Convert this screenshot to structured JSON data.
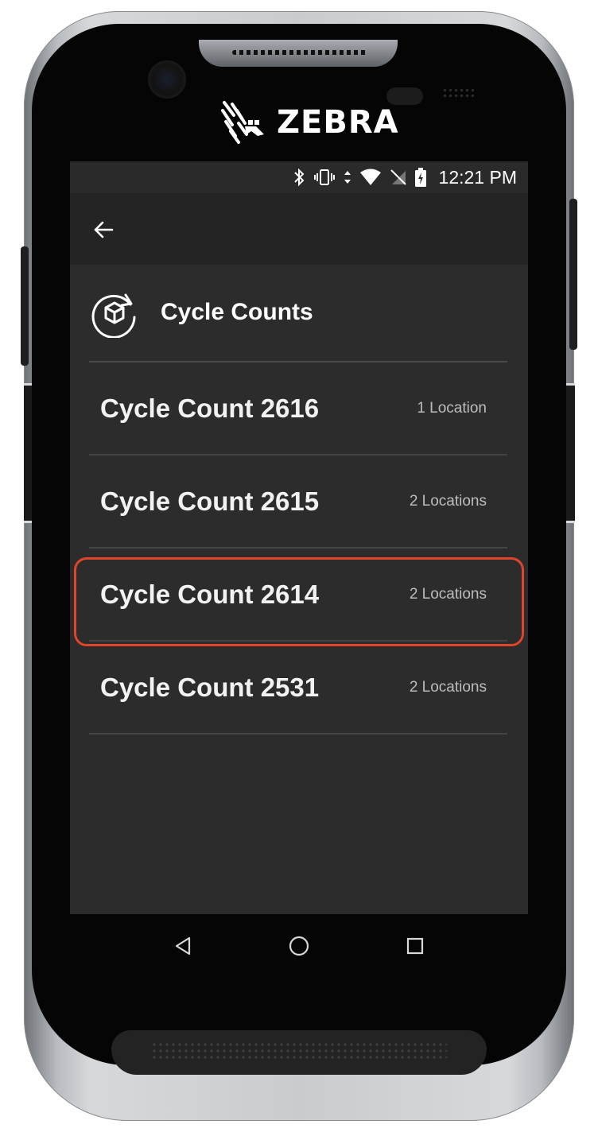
{
  "device": {
    "brand": "ZEBRA"
  },
  "status_bar": {
    "time": "12:21 PM",
    "icons": [
      "bluetooth-icon",
      "vibrate-icon",
      "data-arrows-icon",
      "wifi-icon",
      "no-sim-icon",
      "battery-charging-icon"
    ]
  },
  "app_bar": {
    "back_icon": "arrow-left-icon"
  },
  "section": {
    "icon": "cycle-box-icon",
    "title": "Cycle Counts"
  },
  "cycle_counts": [
    {
      "title": "Cycle Count 2616",
      "locations": "1 Location"
    },
    {
      "title": "Cycle Count 2615",
      "locations": "2 Locations"
    },
    {
      "title": "Cycle Count 2614",
      "locations": "2 Locations",
      "highlighted": true
    },
    {
      "title": "Cycle Count 2531",
      "locations": "2 Locations"
    }
  ],
  "nav_bar": {
    "icons": [
      "back-triangle-icon",
      "home-circle-icon",
      "recents-square-icon"
    ]
  },
  "colors": {
    "screen_bg": "#2c2c2c",
    "app_bar_bg": "#242424",
    "highlight": "#e0452a",
    "text_primary": "#f2f2f2",
    "text_secondary": "#bdbdbd"
  }
}
